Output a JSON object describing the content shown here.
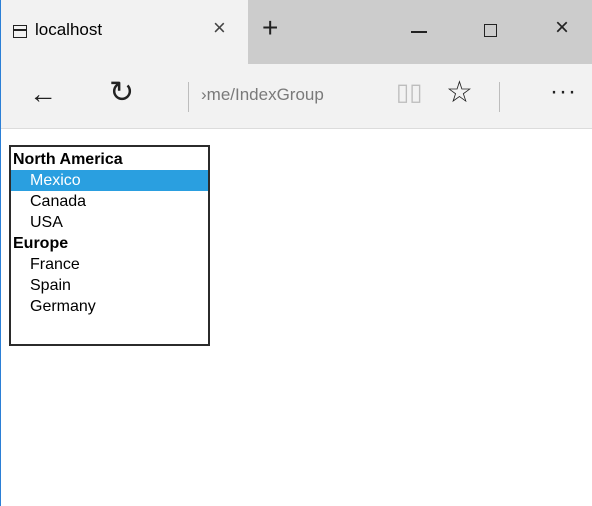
{
  "browser": {
    "tab": {
      "title": "localhost",
      "close_glyph": "×",
      "icon": "tab-page-icon"
    },
    "new_tab_glyph": "+",
    "window_controls": {
      "minimize": "minimize-icon",
      "maximize": "maximize-icon",
      "close_glyph": "×"
    },
    "nav": {
      "back_glyph": "←",
      "refresh_glyph": "↻",
      "address": "›me/IndexGroup",
      "reading_glyph": "▯▯",
      "favorite_glyph": "☆",
      "more_glyph": "···"
    }
  },
  "listbox": {
    "groups": [
      {
        "label": "North America",
        "options": [
          "Mexico",
          "Canada",
          "USA"
        ]
      },
      {
        "label": "Europe",
        "options": [
          "France",
          "Spain",
          "Germany"
        ]
      }
    ],
    "selected": "Mexico"
  },
  "colors": {
    "selected_bg": "#2a9fe0",
    "tab_bg": "#f2f2f2",
    "tabbar_bg": "#cccccc"
  }
}
